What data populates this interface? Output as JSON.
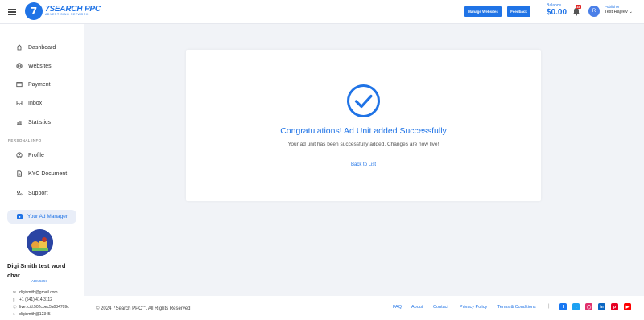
{
  "header": {
    "logo_brand": "7SEARCH PPC",
    "logo_tagline": "ADVERTISING NETWORK",
    "manage_websites_label": "Manage Websites",
    "feedback_label": "Feedback",
    "balance_label": "Balance",
    "balance_amount": "$0.00",
    "notification_count": "34",
    "avatar_initial": "R",
    "user_role": "Publisher",
    "user_name": "Test Rajeev ⌄"
  },
  "sidebar": {
    "items": [
      {
        "label": "Dashboard",
        "icon": "home-icon"
      },
      {
        "label": "Websites",
        "icon": "globe-icon"
      },
      {
        "label": "Payment",
        "icon": "payment-icon"
      },
      {
        "label": "Inbox",
        "icon": "inbox-icon"
      },
      {
        "label": "Statistics",
        "icon": "statistics-icon"
      }
    ],
    "section_label": "PERSONAL INFO",
    "personal_items": [
      {
        "label": "Profile",
        "icon": "profile-icon"
      },
      {
        "label": "KYC Document",
        "icon": "document-icon"
      },
      {
        "label": "Support",
        "icon": "support-icon"
      }
    ],
    "ad_manager_label": "Your Ad Manager",
    "manager": {
      "name": "Digi Smith test word char",
      "id": "ADM5357",
      "email": "digismith@gmail.com",
      "phone": "+1 (541) 414-3112",
      "skype": "live:.cid.502cbec5a034709c",
      "telegram": "digismith@12345"
    }
  },
  "main": {
    "title": "Congratulations! Ad Unit added Successfully",
    "message": "Your ad unit has been successfully added. Changes are now live!",
    "back_link": "Back to List"
  },
  "footer": {
    "copyright": "© 2024 7Search PPC",
    "copyright_tm": "TM",
    "copyright_tail": ". All Rights Reserved",
    "links": [
      "FAQ",
      "About",
      "Contact",
      "Privacy Policy",
      "Terms & Conditions"
    ],
    "separator": "|"
  },
  "colors": {
    "accent": "#1f73e6",
    "background": "#f1f3f7"
  }
}
